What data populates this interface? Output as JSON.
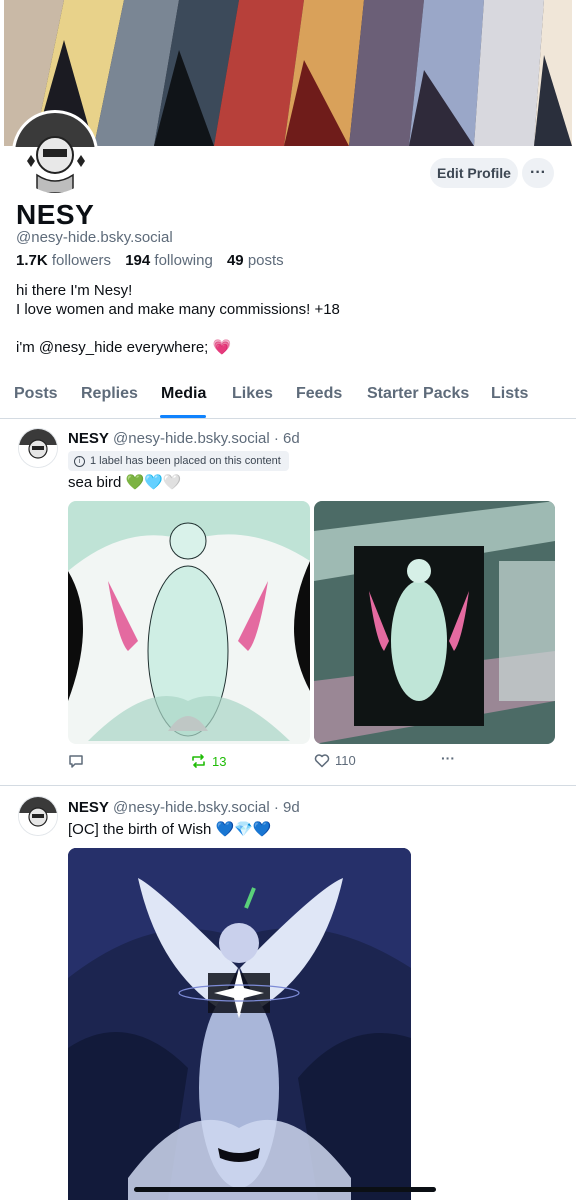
{
  "profile": {
    "display_name": "NESY",
    "handle": "@nesy-hide.bsky.social",
    "followers_count": "1.7K",
    "followers_label": "followers",
    "following_count": "194",
    "following_label": "following",
    "posts_count": "49",
    "posts_label": "posts",
    "bio_line1": "hi there I'm Nesy!",
    "bio_line2": "I love women and make many commissions! +18",
    "bio_line3": "i'm @nesy_hide everywhere; 💗",
    "edit_profile_label": "Edit Profile",
    "more_label": "···"
  },
  "tabs": [
    {
      "label": "Posts"
    },
    {
      "label": "Replies"
    },
    {
      "label": "Media"
    },
    {
      "label": "Likes"
    },
    {
      "label": "Feeds"
    },
    {
      "label": "Starter Packs"
    },
    {
      "label": "Lists"
    }
  ],
  "active_tab": "Media",
  "posts": [
    {
      "author": "NESY",
      "handle": "@nesy-hide.bsky.social",
      "time": "· 6d",
      "label_notice": "1 label has been placed on this content",
      "text": "sea bird 💚🩵🤍",
      "reply_icon": "reply-icon",
      "repost_count": "13",
      "like_count": "110",
      "more_label": "···"
    },
    {
      "author": "NESY",
      "handle": "@nesy-hide.bsky.social",
      "time": "· 9d",
      "text": "[OC] the birth of Wish 💙💎💙"
    }
  ],
  "colors": {
    "accent": "#1083fe",
    "repost_green": "#20bc07",
    "muted_text": "#5e6b7a",
    "divider": "#d4dbe2",
    "button_bg": "#eef1f5"
  }
}
